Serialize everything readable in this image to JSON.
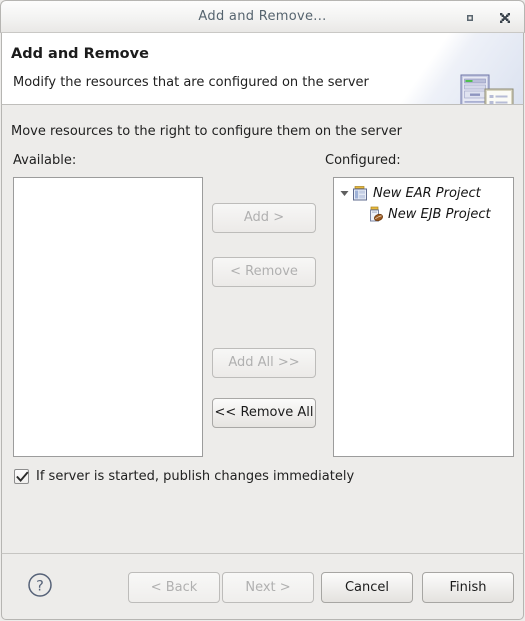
{
  "window": {
    "title": "Add and Remove...",
    "controls": {
      "maximize": "maximize-icon",
      "close": "close-icon"
    }
  },
  "header": {
    "title": "Add and Remove",
    "subtitle": "Modify the resources that are configured on the server",
    "icon": "server-and-document-icon"
  },
  "main": {
    "instruction": "Move resources to the right to configure them on the server",
    "available": {
      "label": "Available:",
      "items": []
    },
    "configured": {
      "label": "Configured:",
      "items": [
        {
          "label": "New EAR Project",
          "icon": "ear-project-icon",
          "expanded": true,
          "indent": 0
        },
        {
          "label": "New EJB Project",
          "icon": "ejb-project-icon",
          "expanded": false,
          "indent": 1
        }
      ]
    },
    "transfer_buttons": [
      {
        "label": "Add >",
        "enabled": false
      },
      {
        "label": "< Remove",
        "enabled": false
      },
      {
        "label": "Add All >>",
        "enabled": false
      },
      {
        "label": "<< Remove All",
        "enabled": true
      }
    ],
    "publish_checkbox": {
      "label": "If server is started, publish changes immediately",
      "checked": true
    }
  },
  "footer": {
    "help": "help-icon",
    "buttons": [
      {
        "label": "< Back",
        "enabled": false
      },
      {
        "label": "Next >",
        "enabled": false
      },
      {
        "label": "Cancel",
        "enabled": true
      },
      {
        "label": "Finish",
        "enabled": true
      }
    ]
  },
  "colors": {
    "dialog_bg": "#edecea",
    "header_bg": "#ffffff",
    "title_text": "#56646f",
    "body_text": "#1f1f1f",
    "disabled_text": "#b0b0b0",
    "border": "#b6b5b2",
    "list_border": "#9c9c9c"
  }
}
